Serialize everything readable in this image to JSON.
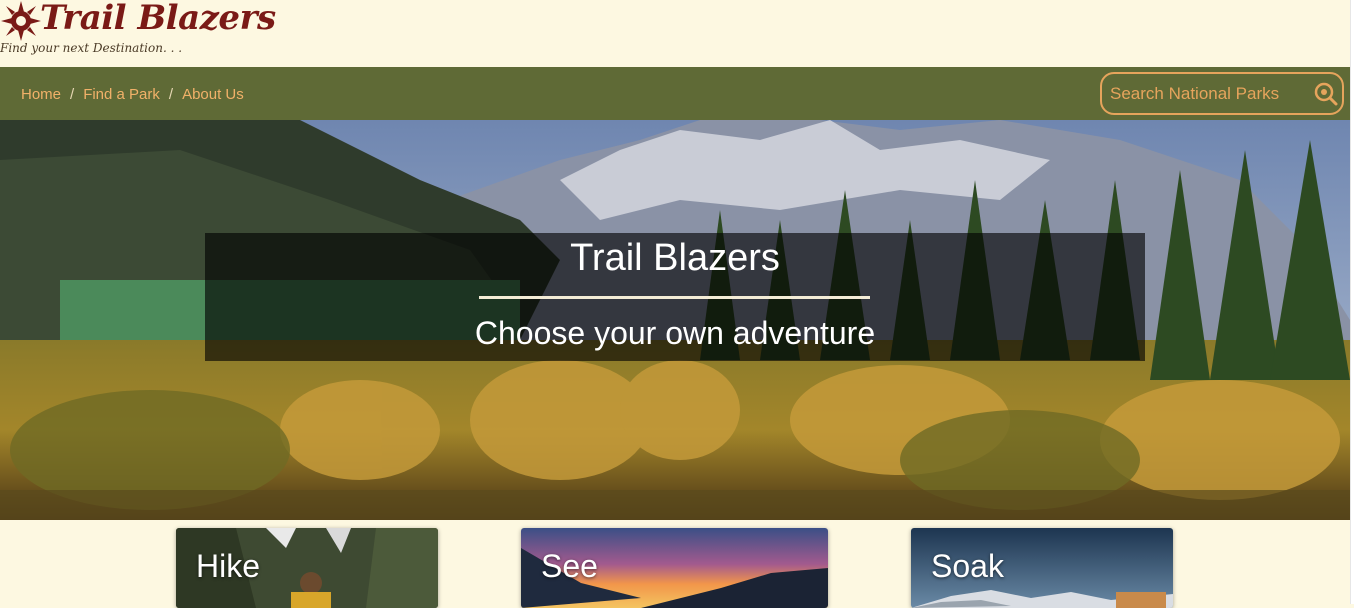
{
  "brand": {
    "name": "Trail Blazers",
    "tagline": "Find your next Destination. . ."
  },
  "nav": {
    "breadcrumb": [
      {
        "label": "Home"
      },
      {
        "label": "Find a Park"
      },
      {
        "label": "About Us"
      }
    ],
    "separator": "/",
    "search": {
      "placeholder": "Search National Parks",
      "value": ""
    }
  },
  "hero": {
    "title": "Trail Blazers",
    "subtitle": "Choose your own adventure"
  },
  "cards": [
    {
      "label": "Hike"
    },
    {
      "label": "See"
    },
    {
      "label": "Soak"
    }
  ],
  "colors": {
    "background": "#fdf8e1",
    "navbar": "#5f6a36",
    "link": "#f1b169",
    "brand": "#7a1a16",
    "search_border": "#e6a45c"
  },
  "icons": {
    "logo": "sun-icon",
    "search": "search-icon"
  }
}
